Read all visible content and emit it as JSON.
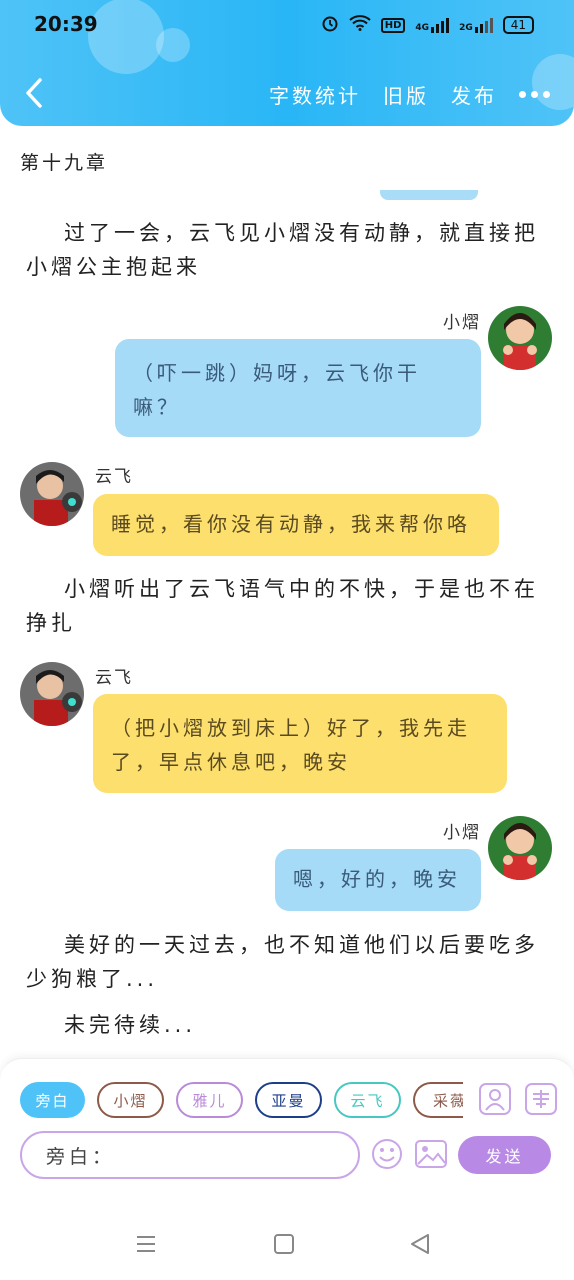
{
  "status": {
    "time": "20:39",
    "battery": "41",
    "hd": "HD",
    "net1": "4G",
    "net2": "2G"
  },
  "header": {
    "actions": [
      "字数统计",
      "旧版",
      "发布"
    ]
  },
  "chapter": {
    "title": "第十九章"
  },
  "messages": {
    "narr1": "过了一会，云飞见小熠没有动静，就直接把小熠公主抱起来",
    "m1_name": "小熠",
    "m1_text": "（吓一跳）妈呀，云飞你干嘛？",
    "m2_name": "云飞",
    "m2_text": "睡觉，看你没有动静，我来帮你咯",
    "narr2": "小熠听出了云飞语气中的不快，于是也不在挣扎",
    "m3_name": "云飞",
    "m3_text": "（把小熠放到床上）好了，我先走了，早点休息吧，晚安",
    "m4_name": "小熠",
    "m4_text": "嗯，好的，晚安",
    "narr3": "美好的一天过去，也不知道他们以后要吃多少狗粮了...",
    "narr4": "未完待续..."
  },
  "roles": [
    {
      "label": "旁白",
      "color": "#4fc3f7"
    },
    {
      "label": "小熠",
      "color": "#8d5a4a"
    },
    {
      "label": "雅儿",
      "color": "#b98ad8"
    },
    {
      "label": "亚曼",
      "color": "#1d3f8a"
    },
    {
      "label": "云飞",
      "color": "#46c8c0"
    },
    {
      "label": "采薇",
      "color": "#8d5a4a"
    }
  ],
  "composer": {
    "prefix": "旁白：",
    "send_label": "发送"
  },
  "icons": {
    "back": "chevron-left-icon",
    "more": "more-dots-icon",
    "role": "person-icon",
    "tag": "tag-icon",
    "emoji": "emoji-icon",
    "image": "image-icon"
  },
  "colors": {
    "accent": "#29b6f6",
    "blue_bubble": "#a6dbf7",
    "yellow_bubble": "#fddf6d",
    "send": "#b88ae6"
  }
}
